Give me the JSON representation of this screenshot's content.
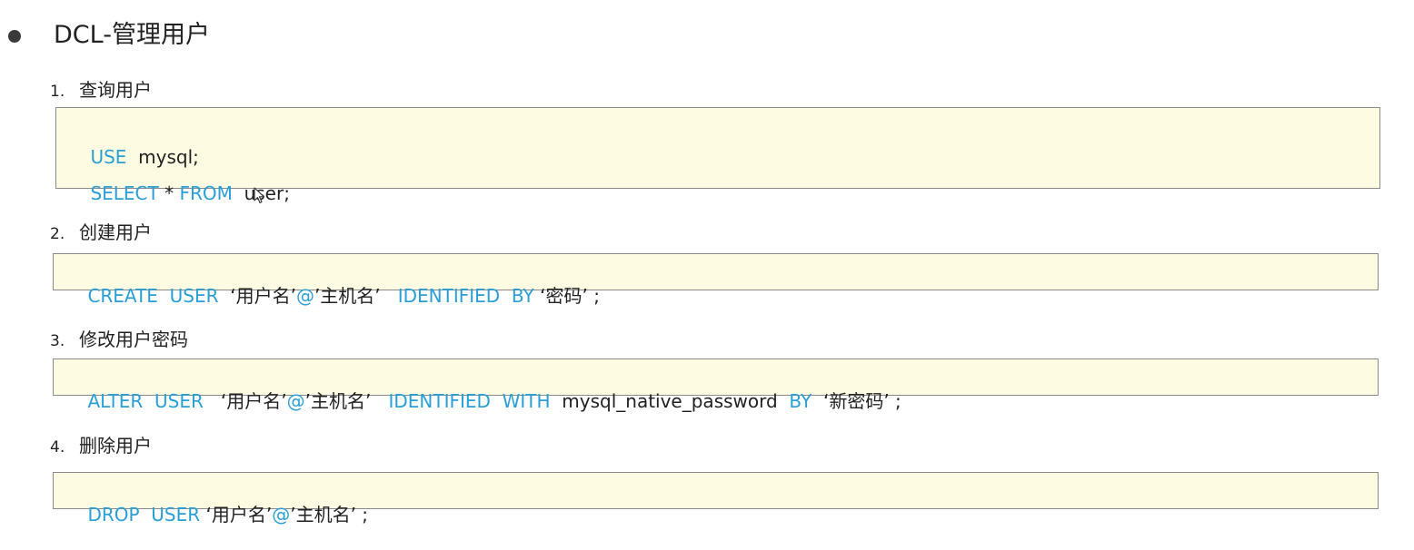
{
  "title": "DCL-管理用户",
  "sections": [
    {
      "number": "1.",
      "heading": "查询用户",
      "lines": [
        [
          "USE",
          "  mysql;"
        ],
        [
          "SELECT",
          " * ",
          "FROM",
          "  user;"
        ]
      ]
    },
    {
      "number": "2.",
      "heading": "创建用户",
      "lines": [
        [
          "CREATE",
          "  ",
          "USER",
          "  ‘用户名’",
          "@",
          "’主机名’   ",
          "IDENTIFIED",
          "  ",
          "BY",
          " ‘密码’ ;"
        ]
      ]
    },
    {
      "number": "3.",
      "heading": "修改用户密码",
      "lines": [
        [
          "ALTER",
          "  ",
          "USER",
          "   ‘用户名’",
          "@",
          "’主机名’   ",
          "IDENTIFIED",
          "  ",
          "WITH",
          "  mysql_native_password  ",
          "BY",
          "  ‘新密码’ ;"
        ]
      ]
    },
    {
      "number": "4.",
      "heading": "删除用户",
      "lines": [
        [
          "DROP",
          "  ",
          "USER",
          " ‘用户名’",
          "@",
          "’主机名’ ;"
        ]
      ]
    }
  ],
  "colors": {
    "keyword": "#2a9fd6",
    "text": "#222222",
    "code_background": "#fefbe3",
    "code_border": "#8a8a8a"
  }
}
